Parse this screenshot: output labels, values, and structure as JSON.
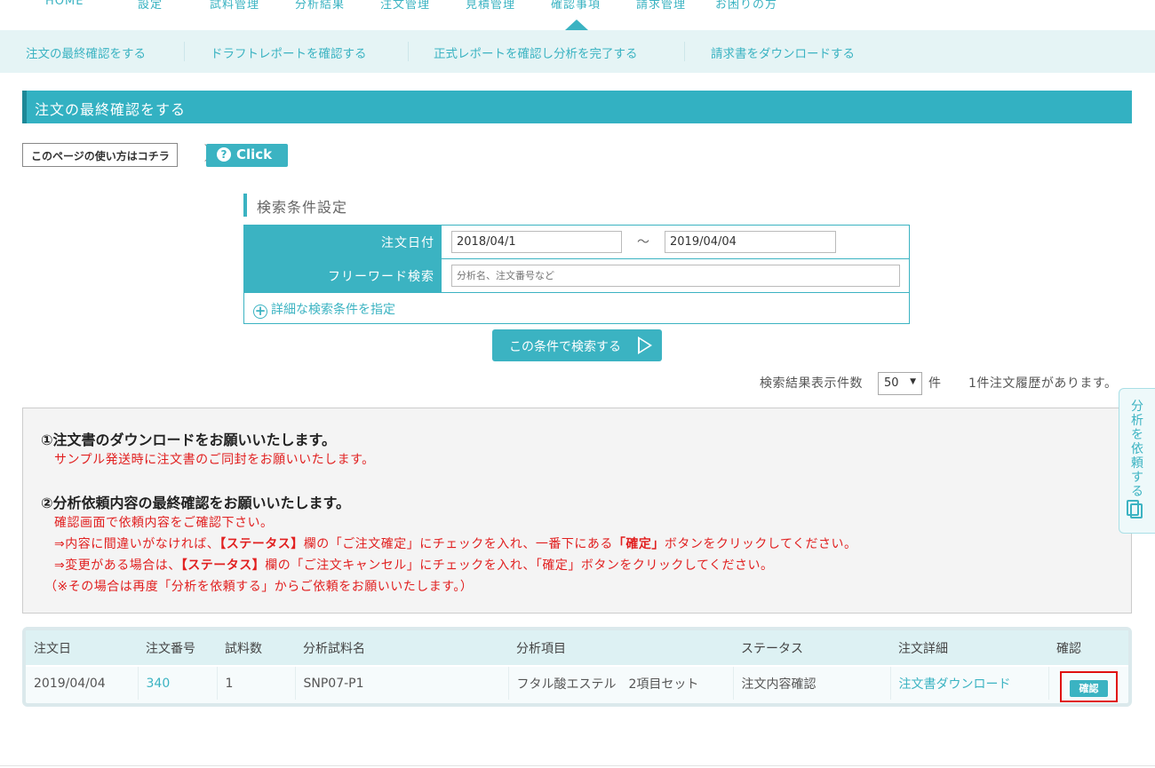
{
  "topnav": {
    "items": [
      "HOME",
      "設定",
      "試料管理",
      "分析結果",
      "注文管理",
      "見積管理",
      "確認事項",
      "請求管理",
      "お困りの方"
    ],
    "active": "確認事項"
  },
  "subnav": {
    "items": [
      "注文の最終確認をする",
      "ドラフトレポートを確認する",
      "正式レポートを確認し分析を完了する",
      "請求書をダウンロードする"
    ]
  },
  "page_title": "注文の最終確認をする",
  "howto": {
    "label": "このページの使い方はコチラ",
    "click_label": "Click",
    "q": "?"
  },
  "search": {
    "title": "検索条件設定",
    "date_label": "注文日付",
    "date_from": "2018/04/1",
    "tilde": "〜",
    "date_to": "2019/04/04",
    "free_label": "フリーワード検索",
    "free_placeholder": "分析名、注文番号など",
    "advanced": "詳細な検索条件を指定",
    "advanced_icon": "+",
    "button": "この条件で検索する"
  },
  "results_meta": {
    "per_page_label": "検索結果表示件数",
    "per_page": "50",
    "per_page_arrow": "▼",
    "unit": "件",
    "summary": "1件注文履歴があります。"
  },
  "notice": {
    "h1": "①注文書のダウンロードをお願いいたします。",
    "l1": "サンプル発送時に注文書のご同封をお願いいたします。",
    "h2": "②分析依頼内容の最終確認をお願いいたします。",
    "l2": "確認画面で依頼内容をご確認下さい。",
    "l3a": "⇒内容に間違いがなければ、",
    "l3b": "【ステータス】",
    "l3c": "欄の「ご注文確定」にチェックを入れ、一番下にある",
    "l3d": "「確定」",
    "l3e": "ボタンをクリックしてください。",
    "l4a": "⇒変更がある場合は、",
    "l4b": "【ステータス】",
    "l4c": "欄の「ご注文キャンセル」にチェックを入れ、「確定」ボタンをクリックしてください。",
    "l5": "（※その場合は再度「分析を依頼する」からご依頼をお願いいたします。）"
  },
  "side_tab": {
    "label": "分析を依頼する",
    "icon": "copy-icon"
  },
  "table": {
    "headers": [
      "注文日",
      "注文番号",
      "試料数",
      "分析試料名",
      "分析項目",
      "ステータス",
      "注文詳細",
      "確認"
    ],
    "row": {
      "date": "2019/04/04",
      "order_no": "340",
      "samples": "1",
      "sample_name": "SNP07-P1",
      "item": "フタル酸エステル　2項目セット",
      "status": "注文内容確認",
      "detail": "注文書ダウンロード",
      "confirm": "確認"
    }
  },
  "colors": {
    "accent": "#3bb3c2",
    "alert": "#e12020"
  }
}
